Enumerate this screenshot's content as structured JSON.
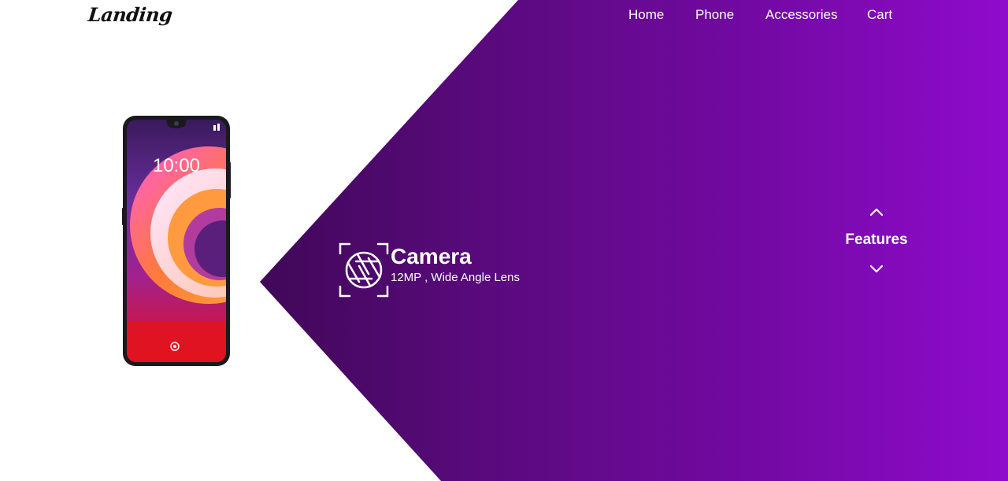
{
  "header": {
    "logo_text": "Landing",
    "nav": [
      "Home",
      "Phone",
      "Accessories",
      "Cart"
    ]
  },
  "phone": {
    "clock": "10:00"
  },
  "feature": {
    "icon": "camera-aperture-icon",
    "title": "Camera",
    "subtitle": "12MP , Wide Angle Lens"
  },
  "carousel": {
    "label": "Features",
    "up_icon": "chevron-up-icon",
    "down_icon": "chevron-down-icon"
  },
  "colors": {
    "background": "#ffffff",
    "gradient_start": "#2e0440",
    "gradient_end": "#8f0bcc",
    "text_light": "#ffffff",
    "logo": "#111111"
  }
}
